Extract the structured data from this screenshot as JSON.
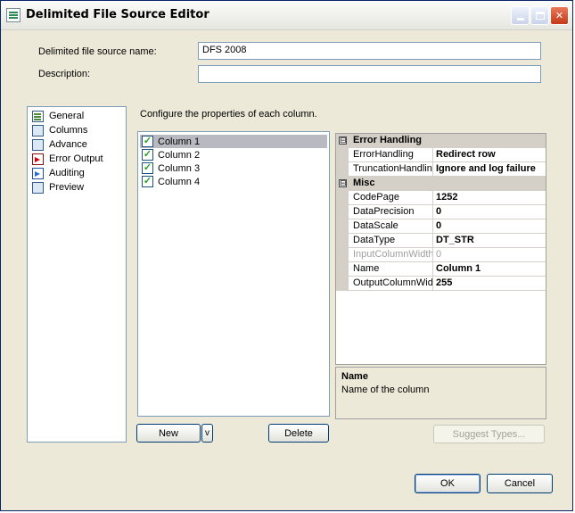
{
  "window": {
    "title": "Delimited File Source Editor"
  },
  "form": {
    "name_label": "Delimited file source name:",
    "name_value": "DFS 2008",
    "description_label": "Description:",
    "description_value": ""
  },
  "nav": {
    "items": [
      {
        "label": "General",
        "icon": "general-icon"
      },
      {
        "label": "Columns",
        "icon": "columns-icon"
      },
      {
        "label": "Advance",
        "icon": "advance-icon"
      },
      {
        "label": "Error Output",
        "icon": "error-output-icon"
      },
      {
        "label": "Auditing",
        "icon": "auditing-icon"
      },
      {
        "label": "Preview",
        "icon": "preview-icon"
      }
    ]
  },
  "columns": {
    "instruction": "Configure the properties of each column.",
    "items": [
      {
        "label": "Column 1",
        "checked": true,
        "selected": true
      },
      {
        "label": "Column 2",
        "checked": true,
        "selected": false
      },
      {
        "label": "Column 3",
        "checked": true,
        "selected": false
      },
      {
        "label": "Column 4",
        "checked": true,
        "selected": false
      }
    ],
    "new_label": "New",
    "new_dropdown_label": "v",
    "delete_label": "Delete"
  },
  "properties": {
    "categories": [
      {
        "label": "Error Handling",
        "toggle": "⊟",
        "rows": [
          {
            "name": "ErrorHandling",
            "value": "Redirect row",
            "disabled": false
          },
          {
            "name": "TruncationHandling",
            "value": "Ignore and log failure",
            "disabled": false
          }
        ]
      },
      {
        "label": "Misc",
        "toggle": "⊟",
        "rows": [
          {
            "name": "CodePage",
            "value": "1252",
            "disabled": false
          },
          {
            "name": "DataPrecision",
            "value": "0",
            "disabled": false
          },
          {
            "name": "DataScale",
            "value": "0",
            "disabled": false
          },
          {
            "name": "DataType",
            "value": "DT_STR",
            "disabled": false
          },
          {
            "name": "InputColumnWidth",
            "value": "0",
            "disabled": true
          },
          {
            "name": "Name",
            "value": "Column 1",
            "disabled": false
          },
          {
            "name": "OutputColumnWidth",
            "value": "255",
            "disabled": false
          }
        ]
      }
    ],
    "description_title": "Name",
    "description_text": "Name of the column"
  },
  "buttons": {
    "suggest_types": "Suggest Types...",
    "ok": "OK",
    "cancel": "Cancel"
  },
  "colors": {
    "selection": "#b9b9c1",
    "category_bg": "#d4d0c8",
    "border": "#7f9db9",
    "check": "#21a121"
  }
}
